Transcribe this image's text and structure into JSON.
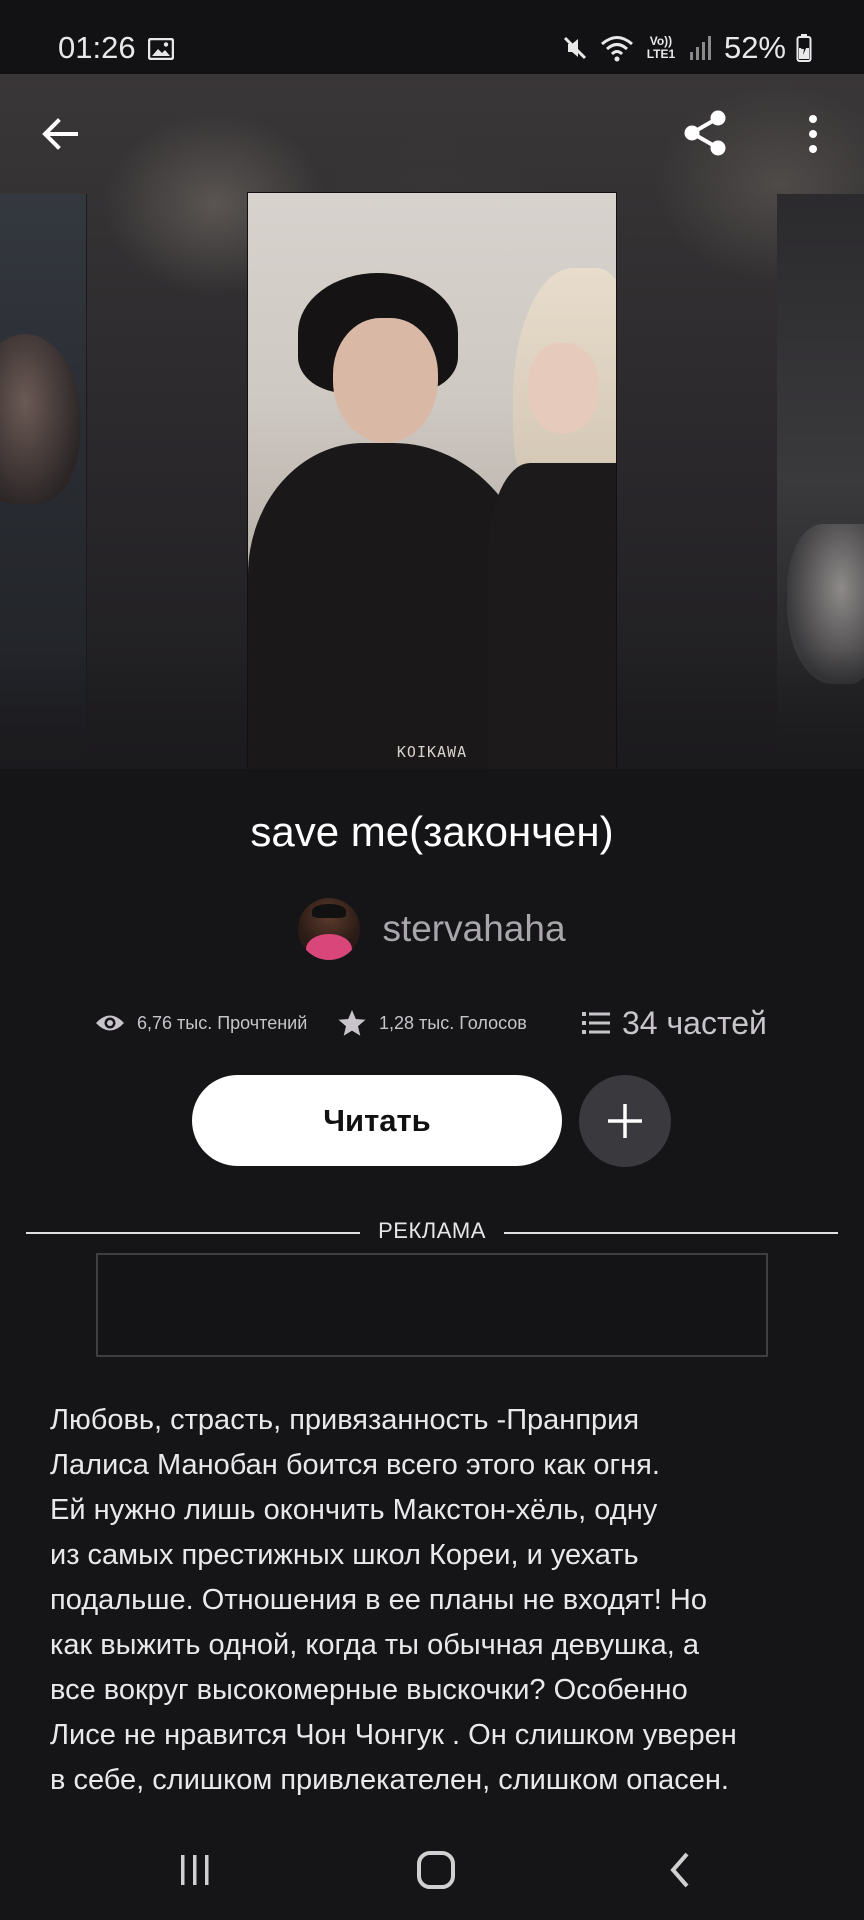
{
  "status_bar": {
    "time": "01:26",
    "network_label": "Vo)) LTE1",
    "battery": "52%",
    "icons": [
      "image-icon",
      "mute-icon",
      "wifi-icon",
      "signal-icon",
      "battery-icon"
    ]
  },
  "header": {
    "icons": [
      "back-arrow-icon",
      "share-icon",
      "more-vertical-icon"
    ]
  },
  "cover": {
    "watermark": "KOIKAWA"
  },
  "book": {
    "title": "save me(закончен)",
    "author": "stervahaha",
    "stats": {
      "reads": "6,76 тыс. Прочтений",
      "votes": "1,28 тыс. Голосов",
      "parts": "34 частей"
    }
  },
  "actions": {
    "read_label": "Читать",
    "add_icon": "plus-icon"
  },
  "ad": {
    "label": "РЕКЛАМА"
  },
  "description": {
    "lines": [
      "Любовь, страсть, привязанность -Пранприя",
      "Лалиса Манобан боится всего этого как огня.",
      "Ей нужно лишь окончить Макстон-хёль, одну",
      "из самых престижных школ Кореи, и уехать",
      "подальше. Отношения в ее планы не входят! Но",
      "как выжить одной, когда ты обычная девушка, а",
      "все вокруг высокомерные выскочки? Особенно",
      "Лисе не нравится Чон Чонгук . Он слишком уверен",
      "в себе, слишком привлекателен, слишком опасен."
    ]
  },
  "nav_bar": {
    "icons": [
      "recent-apps-icon",
      "home-icon",
      "back-icon"
    ]
  },
  "colors": {
    "background": "#151417",
    "button_bg": "#ffffff",
    "add_button_bg": "#3a393d",
    "muted_text": "#a8a6ab"
  }
}
